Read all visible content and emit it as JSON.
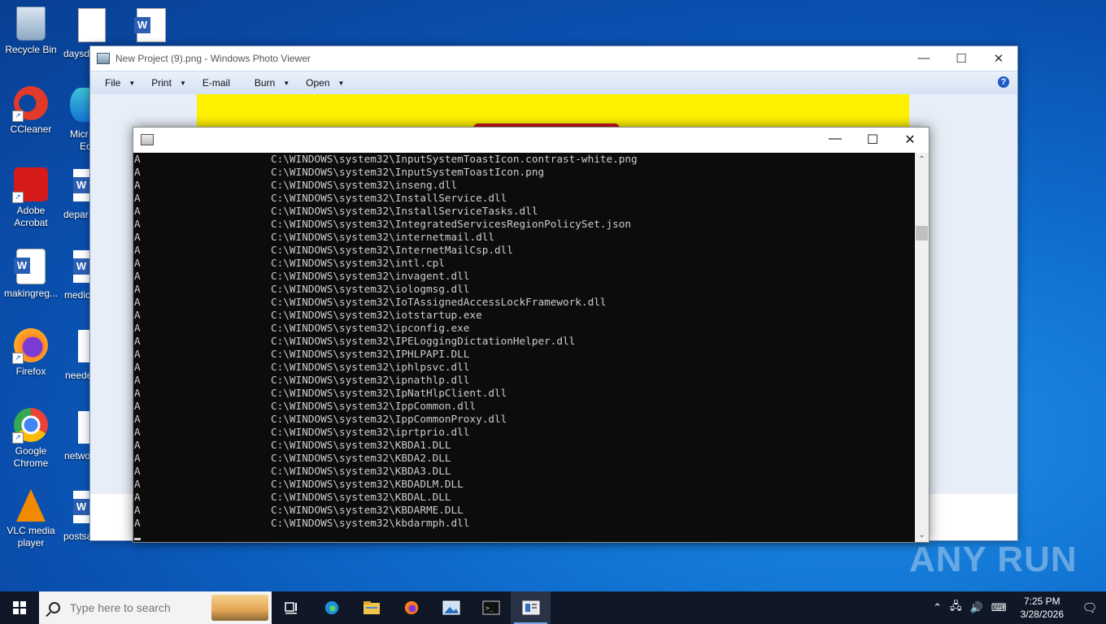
{
  "desktop": {
    "icons": [
      {
        "label": "Recycle Bin",
        "icon": "recycle-bin-icon"
      },
      {
        "label": "CCleaner",
        "icon": "ccleaner-icon"
      },
      {
        "label": "Adobe Acrobat",
        "icon": "acrobat-icon"
      },
      {
        "label": "makingreg...",
        "icon": "word-doc-icon"
      },
      {
        "label": "Firefox",
        "icon": "firefox-icon"
      },
      {
        "label": "Google Chrome",
        "icon": "chrome-icon"
      },
      {
        "label": "VLC media player",
        "icon": "vlc-icon"
      }
    ],
    "second_column": [
      "daysd",
      "Micr",
      "Ec",
      "depar",
      "medic",
      "neede",
      "netwo",
      "postsa"
    ]
  },
  "photo_viewer": {
    "title": "New Project (9).png - Windows Photo Viewer",
    "menu": [
      {
        "label": "File",
        "has_arrow": true
      },
      {
        "label": "Print",
        "has_arrow": true
      },
      {
        "label": "E-mail",
        "has_arrow": false
      },
      {
        "label": "Burn",
        "has_arrow": true
      },
      {
        "label": "Open",
        "has_arrow": true
      }
    ],
    "help": "?",
    "controls": {
      "minimize": "—",
      "maximize": "☐",
      "close": "✕"
    }
  },
  "console": {
    "title": "",
    "controls": {
      "minimize": "—",
      "maximize": "☐",
      "close": "✕"
    },
    "rows": [
      {
        "attr": "A",
        "path": "C:\\WINDOWS\\system32\\InputSystemToastIcon.contrast-white.png"
      },
      {
        "attr": "A",
        "path": "C:\\WINDOWS\\system32\\InputSystemToastIcon.png"
      },
      {
        "attr": "A",
        "path": "C:\\WINDOWS\\system32\\inseng.dll"
      },
      {
        "attr": "A",
        "path": "C:\\WINDOWS\\system32\\InstallService.dll"
      },
      {
        "attr": "A",
        "path": "C:\\WINDOWS\\system32\\InstallServiceTasks.dll"
      },
      {
        "attr": "A",
        "path": "C:\\WINDOWS\\system32\\IntegratedServicesRegionPolicySet.json"
      },
      {
        "attr": "A",
        "path": "C:\\WINDOWS\\system32\\internetmail.dll"
      },
      {
        "attr": "A",
        "path": "C:\\WINDOWS\\system32\\InternetMailCsp.dll"
      },
      {
        "attr": "A",
        "path": "C:\\WINDOWS\\system32\\intl.cpl"
      },
      {
        "attr": "A",
        "path": "C:\\WINDOWS\\system32\\invagent.dll"
      },
      {
        "attr": "A",
        "path": "C:\\WINDOWS\\system32\\iologmsg.dll"
      },
      {
        "attr": "A",
        "path": "C:\\WINDOWS\\system32\\IoTAssignedAccessLockFramework.dll"
      },
      {
        "attr": "A",
        "path": "C:\\WINDOWS\\system32\\iotstartup.exe"
      },
      {
        "attr": "A",
        "path": "C:\\WINDOWS\\system32\\ipconfig.exe"
      },
      {
        "attr": "A",
        "path": "C:\\WINDOWS\\system32\\IPELoggingDictationHelper.dll"
      },
      {
        "attr": "A",
        "path": "C:\\WINDOWS\\system32\\IPHLPAPI.DLL"
      },
      {
        "attr": "A",
        "path": "C:\\WINDOWS\\system32\\iphlpsvc.dll"
      },
      {
        "attr": "A",
        "path": "C:\\WINDOWS\\system32\\ipnathlp.dll"
      },
      {
        "attr": "A",
        "path": "C:\\WINDOWS\\system32\\IpNatHlpClient.dll"
      },
      {
        "attr": "A",
        "path": "C:\\WINDOWS\\system32\\IppCommon.dll"
      },
      {
        "attr": "A",
        "path": "C:\\WINDOWS\\system32\\IppCommonProxy.dll"
      },
      {
        "attr": "A",
        "path": "C:\\WINDOWS\\system32\\iprtprio.dll"
      },
      {
        "attr": "A",
        "path": "C:\\WINDOWS\\system32\\KBDA1.DLL"
      },
      {
        "attr": "A",
        "path": "C:\\WINDOWS\\system32\\KBDA2.DLL"
      },
      {
        "attr": "A",
        "path": "C:\\WINDOWS\\system32\\KBDA3.DLL"
      },
      {
        "attr": "A",
        "path": "C:\\WINDOWS\\system32\\KBDADLM.DLL"
      },
      {
        "attr": "A",
        "path": "C:\\WINDOWS\\system32\\KBDAL.DLL"
      },
      {
        "attr": "A",
        "path": "C:\\WINDOWS\\system32\\KBDARME.DLL"
      },
      {
        "attr": "A",
        "path": "C:\\WINDOWS\\system32\\kbdarmph.dll"
      }
    ]
  },
  "taskbar": {
    "search_placeholder": "Type here to search",
    "apps": [
      "task-view-icon",
      "edge-icon",
      "file-explorer-icon",
      "firefox-icon",
      "photo-viewer-icon",
      "cmd-icon",
      "photo-viewer-active-icon"
    ],
    "clock_time": "7:25 PM",
    "clock_date": "3/28/2026"
  },
  "watermark": "ANY RUN",
  "colors": {
    "console_bg": "#0c0c0c",
    "console_text": "#cccccc",
    "taskbar": "#101828",
    "desktop": "#0f6fcf"
  }
}
